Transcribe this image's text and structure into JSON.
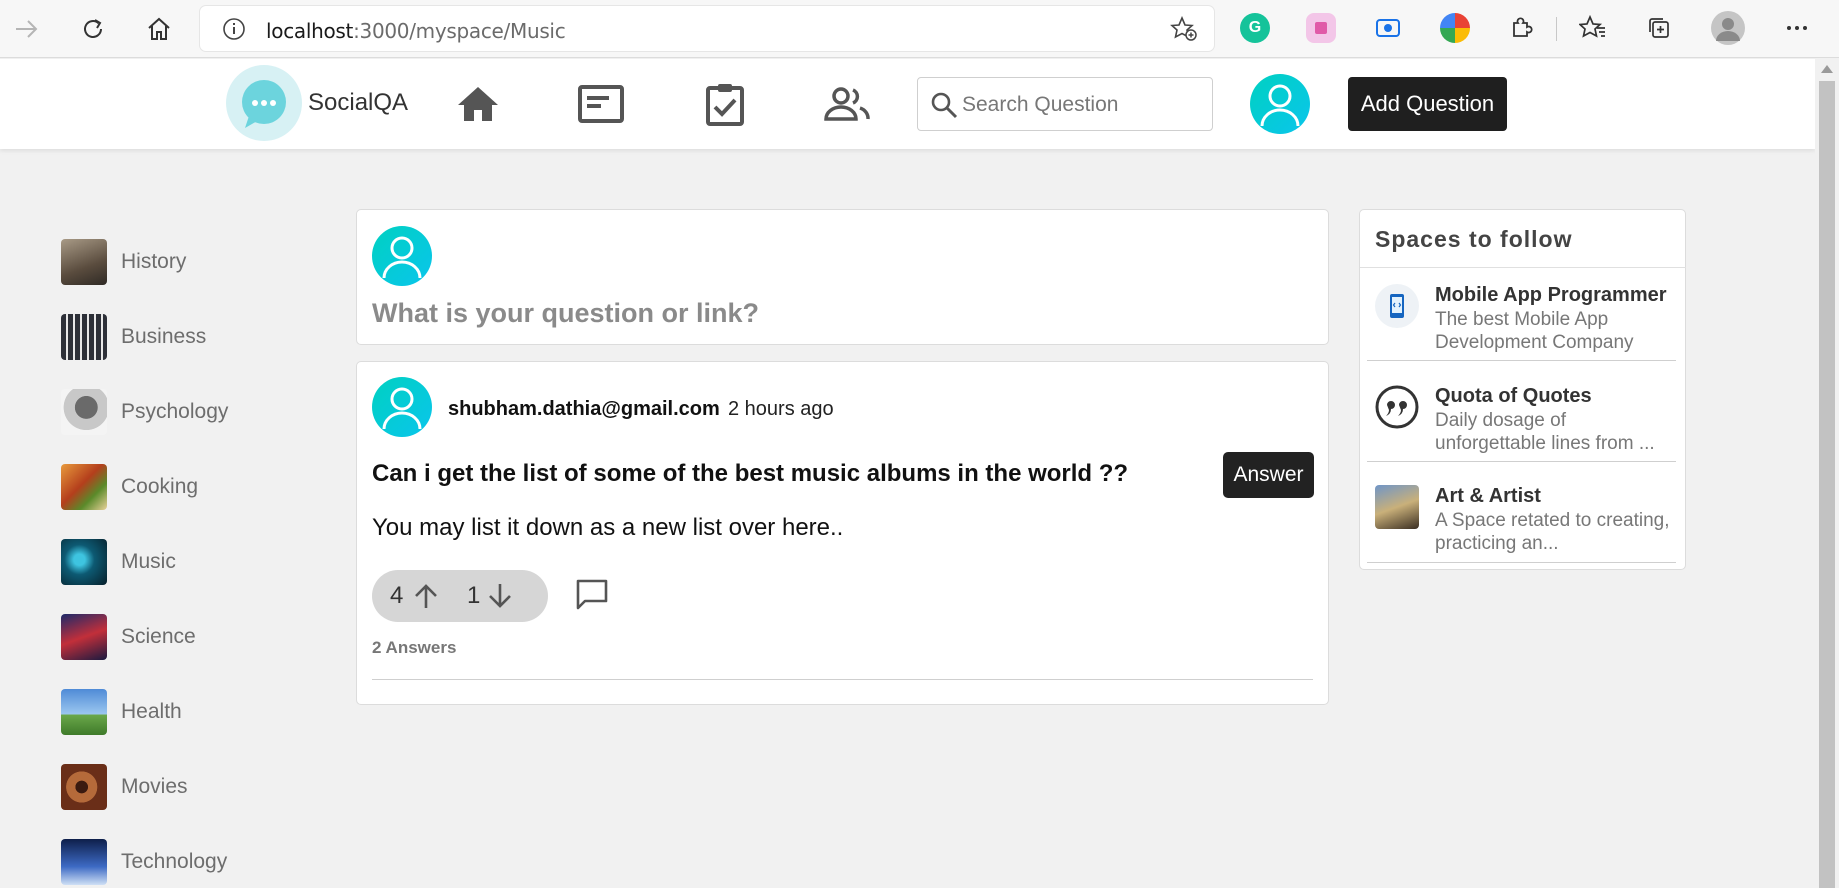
{
  "browser": {
    "url_host": "localhost",
    "url_rest": ":3000/myspace/Music"
  },
  "header": {
    "logo_text": "SocialQA",
    "search_placeholder": "Search Question",
    "add_question_label": "Add Question"
  },
  "sidebar": {
    "items": [
      {
        "label": "History",
        "color": "#7a6a58"
      },
      {
        "label": "Business",
        "color": "#3b3f48"
      },
      {
        "label": "Psychology",
        "color": "#9a9a9a"
      },
      {
        "label": "Cooking",
        "color": "#c46a2c"
      },
      {
        "label": "Music",
        "color": "#0f5f73"
      },
      {
        "label": "Science",
        "color": "#2a2450"
      },
      {
        "label": "Health",
        "color": "#5b8fd0"
      },
      {
        "label": "Movies",
        "color": "#8a4a2a"
      },
      {
        "label": "Technology",
        "color": "#2e4d8a"
      }
    ]
  },
  "ask": {
    "prompt": "What is your question or link?"
  },
  "post": {
    "author": "shubham.dathia@gmail.com",
    "time": "2 hours ago",
    "title": "Can i get the list of some of the best music albums in the world ??",
    "body": "You may list it down as a new list over here..",
    "answer_label": "Answer",
    "upvotes": "4",
    "downvotes": "1",
    "answers_count": "2 Answers"
  },
  "spaces": {
    "title": "Spaces to follow",
    "items": [
      {
        "name": "Mobile App Programmer",
        "desc": "The best Mobile App Development Company"
      },
      {
        "name": "Quota of Quotes",
        "desc": "Daily dosage of unforgettable lines from ..."
      },
      {
        "name": "Art & Artist",
        "desc": "A Space retated to creating, practicing an..."
      }
    ]
  },
  "colors": {
    "accent": "#00cdb7",
    "dark_button": "#1f1f1f"
  }
}
